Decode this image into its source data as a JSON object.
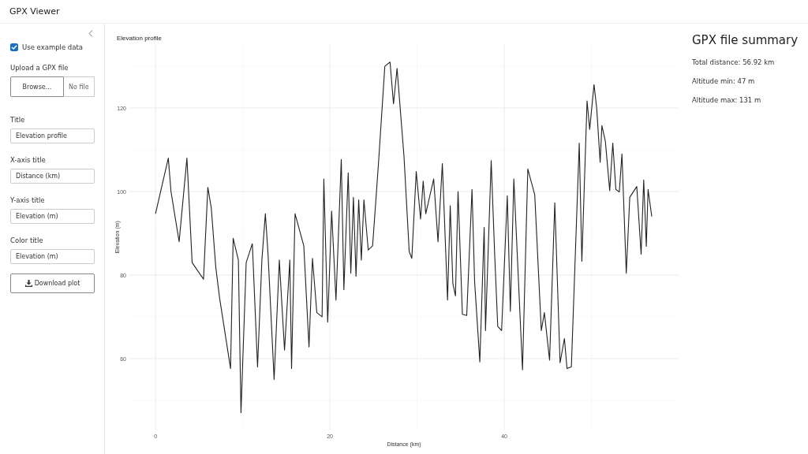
{
  "app_title": "GPX Viewer",
  "sidebar": {
    "use_example": {
      "label": "Use example data",
      "checked": true
    },
    "upload": {
      "label": "Upload a GPX file",
      "button": "Browse...",
      "placeholder": "No file"
    },
    "fields": [
      {
        "label": "Title",
        "value": "Elevation profile"
      },
      {
        "label": "X-axis title",
        "value": "Distance (km)"
      },
      {
        "label": "Y-axis title",
        "value": "Elevation (m)"
      },
      {
        "label": "Color title",
        "value": "Elevation (m)"
      }
    ],
    "download_button": "Download plot"
  },
  "plot": {
    "chart_data": {
      "type": "line",
      "title": "Elevation profile",
      "xlabel": "Distance (km)",
      "ylabel": "Elevation (m)",
      "x": [
        0,
        1.46,
        1.77,
        2.7,
        3.6,
        4.2,
        5.5,
        6.0,
        6.4,
        6.9,
        7.35,
        8.6,
        8.9,
        9.5,
        9.8,
        10.4,
        11.1,
        11.7,
        12.2,
        12.6,
        12.9,
        13.6,
        14.2,
        14.8,
        15.4,
        15.6,
        16.0,
        17.0,
        17.6,
        18.0,
        18.5,
        19.1,
        19.3,
        19.75,
        20.2,
        20.7,
        21.3,
        21.6,
        22.1,
        22.4,
        22.7,
        23.0,
        23.3,
        23.6,
        23.9,
        24.4,
        24.9,
        25.3,
        25.6,
        26.3,
        26.9,
        27.3,
        27.7,
        28.5,
        29.1,
        29.4,
        29.9,
        30.4,
        30.7,
        31.0,
        31.9,
        32.4,
        32.9,
        33.5,
        33.8,
        34.1,
        34.4,
        34.7,
        35.2,
        35.7,
        36.3,
        36.6,
        37.2,
        37.7,
        37.85,
        38.5,
        38.9,
        39.25,
        39.7,
        40.35,
        40.7,
        41.1,
        42.1,
        42.7,
        43.5,
        44.25,
        44.6,
        45.2,
        45.8,
        46.4,
        46.9,
        47.2,
        47.7,
        48.6,
        48.9,
        49.5,
        49.8,
        50.3,
        50.6,
        51.0,
        51.2,
        51.6,
        52.1,
        52.45,
        52.8,
        53.2,
        53.5,
        54.0,
        54.4,
        55.2,
        55.7,
        56.0,
        56.3,
        56.5,
        56.92
      ],
      "grid": true,
      "series": [
        {
          "color": "#222222",
          "values": [
            94.7,
            108,
            100,
            88,
            108,
            83,
            79,
            101,
            96,
            82,
            74.5,
            57.6,
            88.8,
            83.6,
            47,
            83,
            87.5,
            58,
            83.6,
            94.7,
            85,
            55,
            83.6,
            62,
            83.6,
            57.6,
            94.7,
            87,
            62.8,
            84,
            71,
            70,
            103,
            68.7,
            95.3,
            74,
            107.7,
            76.5,
            104.5,
            80.4,
            98.6,
            79.7,
            98,
            83.6,
            98,
            86,
            87,
            98.6,
            107.7,
            130,
            131,
            121,
            129.5,
            108.4,
            85.6,
            84,
            104.8,
            93.4,
            102.5,
            94.7,
            103,
            88,
            106.7,
            74,
            96.6,
            78,
            75,
            100,
            70.6,
            70.3,
            100.5,
            78.4,
            59.2,
            91.4,
            66.7,
            107.4,
            85,
            67.7,
            66.7,
            99,
            71.3,
            103,
            57.3,
            105.4,
            99.2,
            66.7,
            71,
            59.6,
            97.3,
            59,
            64.8,
            57.6,
            58,
            111.6,
            83.3,
            121.7,
            114.9,
            125.6,
            120,
            107,
            115.8,
            112,
            100.2,
            111.6,
            100.5,
            99.9,
            109,
            80.4,
            98.6,
            101.2,
            85,
            102.8,
            86.9,
            100.5,
            94
          ]
        }
      ],
      "xlim": [
        -3,
        60
      ],
      "ylim": [
        42.9,
        135.3
      ],
      "xticks": [
        0,
        20,
        40
      ],
      "yticks": [
        60,
        80,
        100,
        120
      ]
    }
  },
  "summary": {
    "title": "GPX file summary",
    "lines": [
      "Total distance: 56.92 km",
      "Altitude min: 47 m",
      "Altitude max: 131 m"
    ]
  }
}
